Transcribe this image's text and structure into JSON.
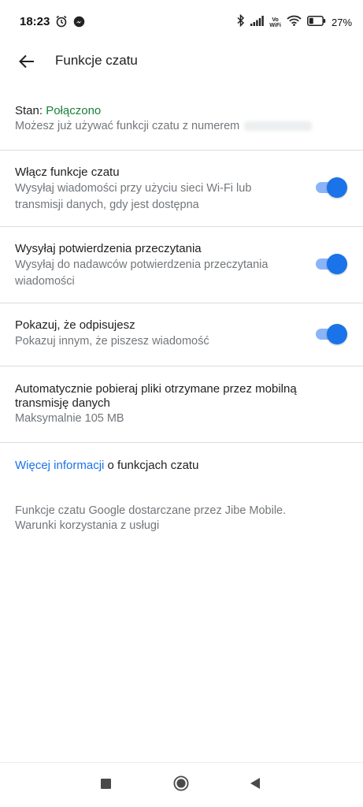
{
  "status_bar": {
    "time": "18:23",
    "vowifi_top": "Vo",
    "vowifi_bottom": "WiFi",
    "battery": "27"
  },
  "header": {
    "title": "Funkcje czatu"
  },
  "status_section": {
    "label_prefix": "Stan: ",
    "status_value": "Połączono",
    "description": "Możesz już używać funkcji czatu z numerem"
  },
  "settings": [
    {
      "title": "Włącz funkcje czatu",
      "line1": "Wysyłaj wiadomości przy użyciu sieci Wi-Fi lub",
      "line2": "transmisji danych, gdy jest dostępna",
      "enabled": true
    },
    {
      "title": "Wysyłaj potwierdzenia przeczytania",
      "line1": "Wysyłaj do nadawców potwierdzenia przeczytania",
      "line2": "wiadomości",
      "enabled": true
    },
    {
      "title": "Pokazuj, że odpisujesz",
      "line1": "Pokazuj innym, że piszesz wiadomość",
      "enabled": true
    }
  ],
  "auto_download": {
    "line1": "Automatycznie pobieraj pliki otrzymane przez mobilną",
    "line2": "transmisję danych",
    "value": "Maksymalnie 105 MB"
  },
  "more_info": {
    "link": "Więcej informacji",
    "rest": " o funkcjach czatu"
  },
  "footer": {
    "line1": "Funkcje czatu Google dostarczane przez Jibe Mobile.",
    "line2": "Warunki korzystania z usługi"
  },
  "colors": {
    "accent": "#1a73e8",
    "toggle_track": "#8ab4f8",
    "status_green": "#188038"
  }
}
